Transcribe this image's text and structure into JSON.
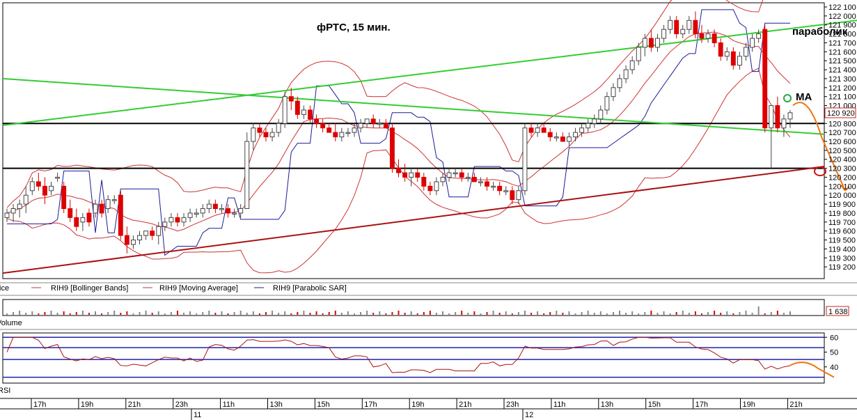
{
  "chart_data": {
    "type": "candlestick",
    "title": "фРТС,  15 мин.",
    "price_panel": {
      "ylim": [
        119100,
        122100
      ],
      "yticks": [
        "122 100",
        "122 000",
        "121 900",
        "121 800",
        "121 700",
        "121 600",
        "121 500",
        "121 400",
        "121 300",
        "121 200",
        "121 100",
        "121 000",
        "120 900",
        "120 800",
        "120 700",
        "120 600",
        "120 500",
        "120 400",
        "120 300",
        "120 200",
        "120 100",
        "120 000",
        "119 900",
        "119 800",
        "119 700",
        "119 600",
        "119 500",
        "119 400",
        "119 300",
        "119 200"
      ],
      "last_price": "120 920",
      "series_legend": [
        "Price",
        "RIH9 [Bollinger Bands]",
        "RIH9 [Moving Average]",
        "RIH9 [Parabolic SAR]"
      ],
      "candles_ohlc": [
        [
          119750,
          119850,
          119700,
          119800
        ],
        [
          119800,
          119900,
          119700,
          119850
        ],
        [
          119850,
          119950,
          119750,
          119900
        ],
        [
          119900,
          120100,
          119800,
          120000
        ],
        [
          120050,
          120200,
          120000,
          120150
        ],
        [
          120150,
          120250,
          120050,
          120100
        ],
        [
          120100,
          120200,
          119900,
          120000
        ],
        [
          120050,
          120150,
          120000,
          120100
        ],
        [
          120200,
          120250,
          120150,
          120200
        ],
        [
          120100,
          120150,
          119800,
          119850
        ],
        [
          119850,
          119950,
          119700,
          119750
        ],
        [
          119750,
          119850,
          119600,
          119650
        ],
        [
          119700,
          119800,
          119600,
          119750
        ],
        [
          119800,
          119850,
          119650,
          119700
        ],
        [
          119800,
          119950,
          119750,
          119900
        ],
        [
          119900,
          119950,
          119750,
          119800
        ],
        [
          119850,
          120000,
          119800,
          119950
        ],
        [
          119950,
          120000,
          119900,
          119950
        ],
        [
          120000,
          120050,
          119500,
          119550
        ],
        [
          119550,
          119650,
          119350,
          119450
        ],
        [
          119450,
          119550,
          119400,
          119500
        ],
        [
          119500,
          119600,
          119450,
          119550
        ],
        [
          119550,
          119600,
          119500,
          119600
        ],
        [
          119600,
          119650,
          119500,
          119550
        ],
        [
          119550,
          119700,
          119450,
          119650
        ],
        [
          119650,
          119750,
          119600,
          119700
        ],
        [
          119700,
          119800,
          119650,
          119750
        ],
        [
          119750,
          119800,
          119650,
          119700
        ],
        [
          119700,
          119800,
          119650,
          119750
        ],
        [
          119750,
          119850,
          119700,
          119800
        ],
        [
          119800,
          119850,
          119750,
          119800
        ],
        [
          119800,
          119900,
          119750,
          119850
        ],
        [
          119850,
          119950,
          119800,
          119900
        ],
        [
          119900,
          119950,
          119800,
          119850
        ],
        [
          119850,
          119900,
          119800,
          119850
        ],
        [
          119850,
          119900,
          119750,
          119800
        ],
        [
          119800,
          119850,
          119750,
          119800
        ],
        [
          119800,
          119900,
          119750,
          119850
        ],
        [
          119850,
          120700,
          119850,
          120600
        ],
        [
          120600,
          120800,
          120500,
          120750
        ],
        [
          120750,
          120800,
          120650,
          120700
        ],
        [
          120700,
          120750,
          120600,
          120650
        ],
        [
          120650,
          120750,
          120600,
          120700
        ],
        [
          120700,
          120850,
          120650,
          120800
        ],
        [
          120800,
          121150,
          120750,
          121100
        ],
        [
          121100,
          121200,
          120950,
          121050
        ],
        [
          121050,
          121100,
          120850,
          120900
        ],
        [
          120900,
          121000,
          120850,
          120950
        ],
        [
          120950,
          121000,
          120800,
          120850
        ],
        [
          120850,
          120900,
          120750,
          120800
        ],
        [
          120800,
          120850,
          120700,
          120750
        ],
        [
          120750,
          120800,
          120700,
          120700
        ],
        [
          120700,
          120800,
          120600,
          120650
        ],
        [
          120650,
          120750,
          120600,
          120700
        ],
        [
          120700,
          120750,
          120650,
          120700
        ],
        [
          120700,
          120800,
          120650,
          120750
        ],
        [
          120750,
          120850,
          120700,
          120800
        ],
        [
          120800,
          120850,
          120750,
          120850
        ],
        [
          120850,
          120900,
          120750,
          120800
        ],
        [
          120800,
          120850,
          120750,
          120800
        ],
        [
          120800,
          120850,
          120750,
          120750
        ],
        [
          120750,
          120800,
          120250,
          120300
        ],
        [
          120300,
          120400,
          120200,
          120250
        ],
        [
          120250,
          120350,
          120150,
          120200
        ],
        [
          120200,
          120300,
          120100,
          120250
        ],
        [
          120250,
          120300,
          120150,
          120200
        ],
        [
          120200,
          120250,
          120050,
          120100
        ],
        [
          120100,
          120150,
          120000,
          120050
        ],
        [
          120050,
          120200,
          120000,
          120150
        ],
        [
          120150,
          120250,
          120100,
          120200
        ],
        [
          120200,
          120300,
          120150,
          120250
        ],
        [
          120250,
          120300,
          120200,
          120250
        ],
        [
          120250,
          120300,
          120150,
          120200
        ],
        [
          120200,
          120250,
          120150,
          120200
        ],
        [
          120200,
          120250,
          120150,
          120150
        ],
        [
          120150,
          120200,
          120100,
          120150
        ],
        [
          120150,
          120200,
          120050,
          120100
        ],
        [
          120100,
          120150,
          120050,
          120100
        ],
        [
          120100,
          120150,
          120000,
          120050
        ],
        [
          120050,
          120100,
          120000,
          120050
        ],
        [
          120050,
          120100,
          119900,
          119950
        ],
        [
          119950,
          120100,
          119900,
          120050
        ],
        [
          120050,
          120800,
          120000,
          120750
        ],
        [
          120750,
          120800,
          120650,
          120700
        ],
        [
          120700,
          120800,
          120650,
          120750
        ],
        [
          120750,
          120800,
          120700,
          120700
        ],
        [
          120700,
          120750,
          120600,
          120650
        ],
        [
          120650,
          120700,
          120600,
          120650
        ],
        [
          120650,
          120700,
          120600,
          120600
        ],
        [
          120600,
          120700,
          120550,
          120650
        ],
        [
          120650,
          120750,
          120600,
          120700
        ],
        [
          120700,
          120800,
          120650,
          120750
        ],
        [
          120750,
          120850,
          120700,
          120800
        ],
        [
          120800,
          120900,
          120750,
          120850
        ],
        [
          120850,
          121000,
          120800,
          120950
        ],
        [
          120950,
          121150,
          120900,
          121100
        ],
        [
          121100,
          121250,
          121050,
          121200
        ],
        [
          121200,
          121350,
          121150,
          121300
        ],
        [
          121300,
          121450,
          121250,
          121400
        ],
        [
          121400,
          121550,
          121350,
          121500
        ],
        [
          121500,
          121700,
          121450,
          121650
        ],
        [
          121650,
          121800,
          121550,
          121750
        ],
        [
          121750,
          121850,
          121600,
          121650
        ],
        [
          121650,
          121800,
          121600,
          121750
        ],
        [
          121750,
          121900,
          121700,
          121850
        ],
        [
          121850,
          122000,
          121800,
          121950
        ],
        [
          121950,
          122000,
          121750,
          121800
        ],
        [
          121800,
          121900,
          121750,
          121850
        ],
        [
          121850,
          122000,
          121800,
          121950
        ],
        [
          121950,
          122050,
          121750,
          121800
        ],
        [
          121800,
          121900,
          121700,
          121750
        ],
        [
          121750,
          121850,
          121700,
          121800
        ],
        [
          121800,
          121850,
          121650,
          121700
        ],
        [
          121700,
          121750,
          121500,
          121550
        ],
        [
          121550,
          121650,
          121500,
          121600
        ],
        [
          121600,
          121650,
          121400,
          121450
        ],
        [
          121450,
          121600,
          121400,
          121550
        ],
        [
          121550,
          121700,
          121500,
          121650
        ],
        [
          121650,
          121800,
          121600,
          121750
        ],
        [
          121750,
          121850,
          121700,
          121800
        ],
        [
          121850,
          121900,
          120700,
          120750
        ],
        [
          120750,
          121000,
          120300,
          121000
        ],
        [
          121000,
          121100,
          120700,
          120750
        ],
        [
          120750,
          120900,
          120650,
          120850
        ],
        [
          120850,
          120950,
          120750,
          120920
        ]
      ],
      "horizontal_levels": [
        120800,
        120300
      ],
      "trend_lines_note": "two green trendlines, one dark-red rising support line",
      "annotations": [
        "параболик",
        "MA"
      ]
    },
    "volume_panel": {
      "label": "Volume",
      "last_value": "1 638"
    },
    "rsi_panel": {
      "label": "RSI",
      "yticks": [
        "60",
        "50",
        "40"
      ],
      "ylim": [
        30,
        62
      ]
    },
    "time_axis": {
      "labels": [
        "17h",
        "19h",
        "21h",
        "23h",
        "11h",
        "13h",
        "15h",
        "17h",
        "19h",
        "21h",
        "23h",
        "11h",
        "13h",
        "15h",
        "17h",
        "19h",
        "21h"
      ],
      "days": [
        "11",
        "12"
      ]
    },
    "colors": {
      "candle_up": "#ffffff",
      "candle_down": "#dd0000",
      "bollinger": "#cc3333",
      "moving_average": "#cc3333",
      "parabolic_sar": "#1a1a99",
      "trendline_green": "#33cc33",
      "support_red": "#aa1111",
      "forecast_orange": "#ee7711",
      "level_black": "#000000",
      "rsi_band": "#2222aa"
    }
  }
}
